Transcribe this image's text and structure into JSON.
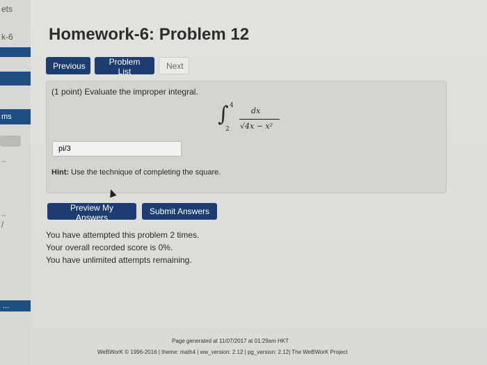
{
  "sidebar": {
    "top_text": "ets",
    "set_text": "k-6",
    "problems_label": "ms",
    "dots1": "..",
    "dots2": "..",
    "dots3": "...",
    "slash": "/"
  },
  "title": "Homework-6: Problem 12",
  "nav": {
    "previous": "Previous",
    "problem_list": "Problem List",
    "next": "Next"
  },
  "problem": {
    "prompt": "(1 point) Evaluate the improper integral.",
    "integral": {
      "upper": "4",
      "lower": "2",
      "numerator": "dx",
      "denominator": "√4x − x²"
    },
    "answer_value": "pi/3",
    "hint_label": "Hint:",
    "hint_text": " Use the technique of completing the square."
  },
  "actions": {
    "preview": "Preview My Answers",
    "submit": "Submit Answers"
  },
  "status": {
    "attempts": "You have attempted this problem 2 times.",
    "score": "Your overall recorded score is 0%.",
    "remaining": "You have unlimited attempts remaining."
  },
  "footer": {
    "generated": "Page generated at 11/07/2017 at 01:29am HKT",
    "copyright": "WeBWorK © 1996-2016 | theme: math4 | ww_version: 2.12 | pg_version: 2.12| The WeBWorK Project"
  }
}
